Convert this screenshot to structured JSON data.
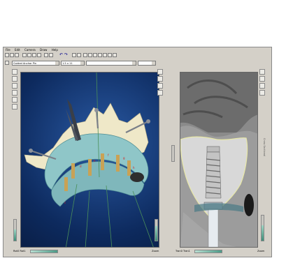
{
  "menu": [
    "File",
    "Edit",
    "Camera",
    "Draw",
    "Help"
  ],
  "options": {
    "implant_selector": "Guided Anchor Pin",
    "size_selector": "1.5 x 11",
    "empty_selector_1": "",
    "empty_selector_2": ""
  },
  "left_view": {
    "bottom_left_label": "Rot0 Rot1",
    "zoom_label": "Zoom",
    "implant_labels": [
      "c",
      "d",
      "e",
      "f",
      "g",
      "h"
    ],
    "slider_level": 0.55
  },
  "right_view": {
    "bottom_left_label": "Tran0 Tran1",
    "zoom_label": "Zoom",
    "side_label": "Cross Sectional",
    "slider_level": 0.6
  },
  "colors": {
    "window_bg": "#d4d0c8",
    "render_bg": "#0d2a5e",
    "gum_tissue": "#8fc6c8",
    "bone": "#efe8c8",
    "implant_gold": "#c9a255",
    "slider_green": "#3d8d78"
  },
  "icons": [
    "new-icon",
    "open-icon",
    "save-icon",
    "print-icon",
    "undo-icon",
    "redo-icon",
    "view-icon",
    "zoom-icon",
    "rotate-icon",
    "pan-icon",
    "measure-icon",
    "select-icon",
    "box-icon",
    "cube-icon",
    "settings-icon"
  ]
}
